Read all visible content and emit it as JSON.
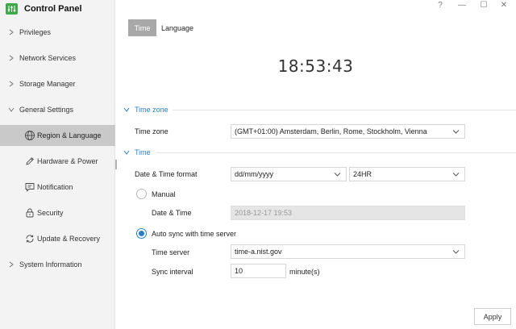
{
  "app": {
    "title": "Control Panel",
    "logo_icon": "equalizer-icon",
    "accent_color": "#3fa84a"
  },
  "window_controls": {
    "help": "?",
    "minimize": "—",
    "maximize": "☐",
    "close": "✕"
  },
  "sidebar": {
    "items": [
      {
        "label": "Privileges"
      },
      {
        "label": "Network Services"
      },
      {
        "label": "Storage Manager"
      },
      {
        "label": "General Settings",
        "expanded": true
      },
      {
        "label": "System Information"
      }
    ],
    "sub_items": [
      {
        "label": "Region & Language",
        "icon": "globe-icon",
        "active": true
      },
      {
        "label": "Hardware & Power",
        "icon": "pen-icon"
      },
      {
        "label": "Notification",
        "icon": "message-icon"
      },
      {
        "label": "Security",
        "icon": "lock-icon"
      },
      {
        "label": "Update & Recovery",
        "icon": "sync-icon"
      }
    ]
  },
  "tabs": [
    {
      "label": "Time",
      "active": true
    },
    {
      "label": "Language",
      "active": false
    }
  ],
  "clock": "18:53:43",
  "timezone_section": {
    "title": "Time zone",
    "label": "Time zone",
    "value": "(GMT+01:00) Amsterdam, Berlin, Rome, Stockholm, Vienna"
  },
  "time_section": {
    "title": "Time",
    "format_label": "Date & Time format",
    "date_format": "dd/mm/yyyy",
    "time_format": "24HR",
    "manual": {
      "label": "Manual",
      "checked": false,
      "datetime_label": "Date & Time",
      "datetime_value": "2018-12-17 19:53"
    },
    "auto": {
      "label": "Auto sync with time server",
      "checked": true,
      "server_label": "Time server",
      "server_value": "time-a.nist.gov",
      "interval_label": "Sync interval",
      "interval_value": "10",
      "interval_unit": "minute(s)"
    }
  },
  "apply_label": "Apply",
  "accent_blue": "#2a7fc6"
}
